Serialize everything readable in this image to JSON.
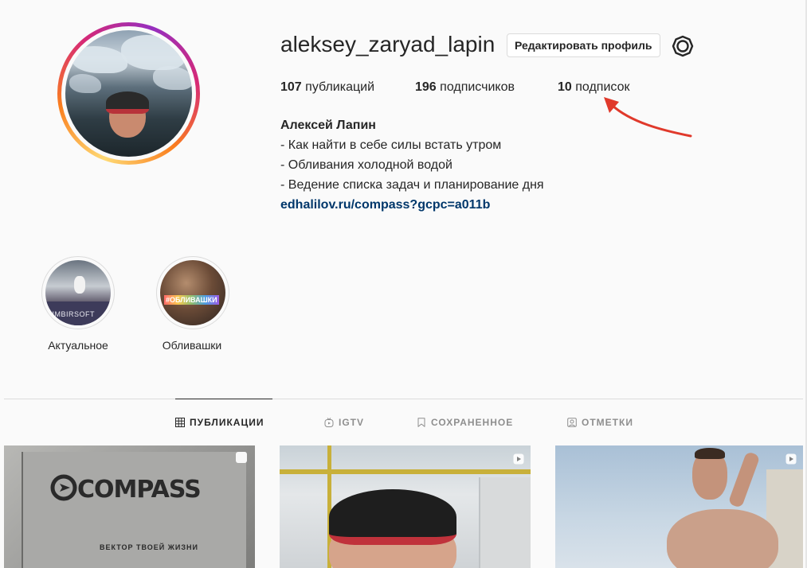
{
  "profile": {
    "username": "aleksey_zaryad_lapin",
    "edit_label": "Редактировать профиль",
    "posts_count": "107",
    "posts_label": "публикаций",
    "followers_count": "196",
    "followers_label": "подписчиков",
    "following_count": "10",
    "following_label": "подписок",
    "full_name": "Алексей Лапин",
    "bio_lines": [
      "- Как найти в себе силы встать утром",
      "- Обливания холодной водой",
      "- Ведение списка задач и планирование дня"
    ],
    "link": "edhalilov.ru/compass?gcpc=a011b"
  },
  "highlights": [
    {
      "label": "Актуальное",
      "image_text": "SIMBIRSOFT"
    },
    {
      "label": "Обливашки",
      "image_text": "#ОБЛИВАШКИ"
    }
  ],
  "tabs": [
    {
      "label": "ПУБЛИКАЦИИ",
      "icon": "grid-icon",
      "active": true
    },
    {
      "label": "IGTV",
      "icon": "igtv-icon",
      "active": false
    },
    {
      "label": "СОХРАНЕННОЕ",
      "icon": "bookmark-icon",
      "active": false
    },
    {
      "label": "ОТМЕТКИ",
      "icon": "tagged-icon",
      "active": false
    }
  ],
  "posts": [
    {
      "logo_text": "COMPASS",
      "tagline": "ВЕКТОР ТВОЕЙ ЖИЗНИ"
    },
    {},
    {}
  ],
  "colors": {
    "link": "#00376b",
    "annotation_arrow": "#e0392b",
    "active_tab": "#262626",
    "inactive_tab": "#8e8e8e"
  }
}
